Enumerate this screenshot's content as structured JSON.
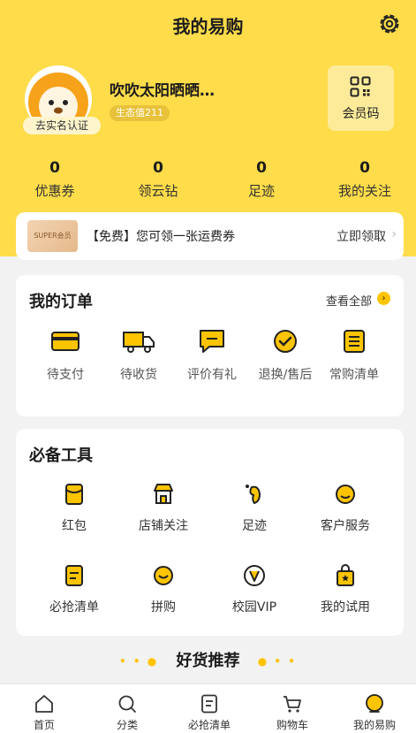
{
  "header": {
    "title": "我的易购"
  },
  "profile": {
    "username": "吹吹太阳晒晒…",
    "verify_label": "去实名认证",
    "eco_badge": "生态值211",
    "member_code_label": "会员码"
  },
  "stats": [
    {
      "value": "0",
      "label": "优惠券"
    },
    {
      "value": "0",
      "label": "领云钻"
    },
    {
      "value": "0",
      "label": "足迹"
    },
    {
      "value": "0",
      "label": "我的关注"
    }
  ],
  "coupon": {
    "logo_text": "SUPER会员",
    "text": "【免费】您可领一张运费券",
    "action": "立即领取"
  },
  "orders": {
    "title": "我的订单",
    "view_all": "查看全部",
    "items": [
      {
        "label": "待支付",
        "icon": "card-icon"
      },
      {
        "label": "待收货",
        "icon": "truck-icon"
      },
      {
        "label": "评价有礼",
        "icon": "comment-icon"
      },
      {
        "label": "退换/售后",
        "icon": "return-icon"
      },
      {
        "label": "常购清单",
        "icon": "list-icon"
      }
    ]
  },
  "tools": {
    "title": "必备工具",
    "items": [
      {
        "label": "红包",
        "icon": "red-packet-icon"
      },
      {
        "label": "店铺关注",
        "icon": "shop-icon"
      },
      {
        "label": "足迹",
        "icon": "footprint-icon"
      },
      {
        "label": "客户服务",
        "icon": "service-icon"
      },
      {
        "label": "必抢清单",
        "icon": "checklist-icon"
      },
      {
        "label": "拼购",
        "icon": "group-buy-icon"
      },
      {
        "label": "校园VIP",
        "icon": "campus-vip-icon"
      },
      {
        "label": "我的试用",
        "icon": "trial-bag-icon"
      }
    ]
  },
  "recommend": {
    "title": "好货推荐"
  },
  "tabbar": [
    {
      "label": "首页",
      "icon": "home-icon"
    },
    {
      "label": "分类",
      "icon": "search-icon"
    },
    {
      "label": "必抢清单",
      "icon": "list-icon"
    },
    {
      "label": "购物车",
      "icon": "cart-icon"
    },
    {
      "label": "我的易购",
      "icon": "profile-icon"
    }
  ],
  "colors": {
    "brand_yellow": "#fedc4a",
    "accent": "#fec400"
  }
}
